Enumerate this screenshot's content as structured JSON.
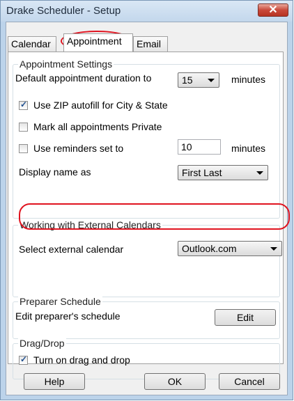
{
  "window": {
    "title": "Drake Scheduler - Setup",
    "close_symbol": "✕"
  },
  "tabs": [
    {
      "label": "Calendar",
      "active": false
    },
    {
      "label": "Appointment",
      "active": true
    },
    {
      "label": "Email",
      "active": false
    }
  ],
  "appointment_settings": {
    "title": "Appointment Settings",
    "duration_label": "Default appointment duration to",
    "duration_value": "15",
    "duration_unit": "minutes",
    "zip_autofill": {
      "label": "Use ZIP autofill for City & State",
      "checked": true
    },
    "private": {
      "label": "Mark all appointments Private",
      "checked": false
    },
    "reminders": {
      "label": "Use reminders set to",
      "checked": false,
      "value": "10",
      "unit": "minutes"
    },
    "display_name_label": "Display name as",
    "display_name_value": "First Last"
  },
  "external": {
    "title": "Working with External Calendars",
    "select_label": "Select external calendar",
    "select_value": "Outlook.com"
  },
  "preparer": {
    "title": "Preparer Schedule",
    "edit_label": "Edit preparer's schedule",
    "edit_button": "Edit"
  },
  "dragdrop": {
    "title": "Drag/Drop",
    "toggle": {
      "label": "Turn on drag and drop",
      "checked": true
    }
  },
  "footer": {
    "help": "Help",
    "ok": "OK",
    "cancel": "Cancel"
  },
  "colors": {
    "highlight": "#e0131f",
    "close_button": "#c9493a",
    "check": "#1f4f8f"
  }
}
